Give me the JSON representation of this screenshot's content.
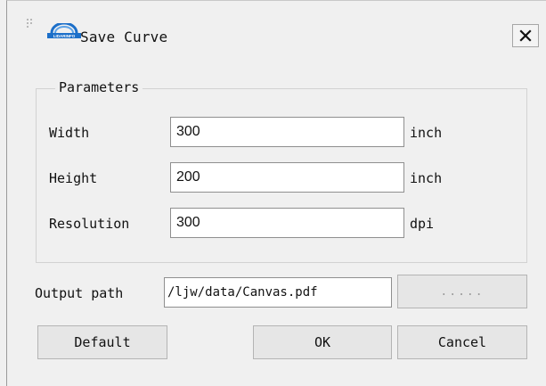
{
  "window": {
    "title": "Save Curve",
    "logo_text": "LIDARINFO",
    "close_glyph": "✕"
  },
  "parameters": {
    "legend": "Parameters",
    "width": {
      "label": "Width",
      "value": "300",
      "unit": "inch"
    },
    "height": {
      "label": "Height",
      "value": "200",
      "unit": "inch"
    },
    "resolution": {
      "label": "Resolution",
      "value": "300",
      "unit": "dpi"
    }
  },
  "output": {
    "label": "Output path",
    "value": "/ljw/data/Canvas.pdf",
    "browse_label": "....."
  },
  "buttons": {
    "default": "Default",
    "ok": "OK",
    "cancel": "Cancel"
  },
  "colors": {
    "background": "#f0f0f0",
    "field_bg": "#ffffff",
    "button_bg": "#e6e6e6",
    "logo_blue": "#1c6fc9"
  },
  "icons": {
    "logo": "lidar-logo-icon",
    "close": "close-icon",
    "grip": "grip-icon"
  }
}
